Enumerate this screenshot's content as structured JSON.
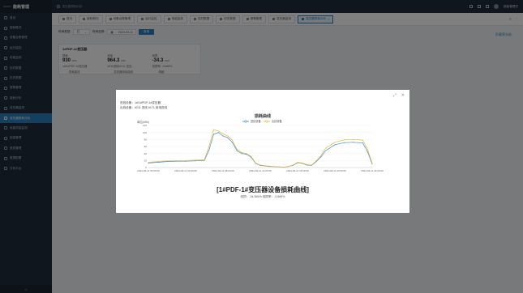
{
  "app": {
    "logo_text": "HNDM",
    "system_name": "能耗管理"
  },
  "sidebar": {
    "items": [
      {
        "label": "首页"
      },
      {
        "label": "能耗概况"
      },
      {
        "label": "设备台账管理"
      },
      {
        "label": "运行监控"
      },
      {
        "label": "电能监测"
      },
      {
        "label": "实时数据"
      },
      {
        "label": "历史数据"
      },
      {
        "label": "报警管理"
      },
      {
        "label": "能耗分析"
      },
      {
        "label": "变压器监测"
      },
      {
        "label": "变压器损耗分析",
        "active": true
      },
      {
        "label": "电能质量监测"
      },
      {
        "label": "用量管理"
      },
      {
        "label": "报表管理"
      },
      {
        "label": "数据配置"
      },
      {
        "label": "分析平台"
      }
    ],
    "collapse_glyph": "«"
  },
  "topbar": {
    "search_placeholder": "变压器损耗分析",
    "user_name": "超级管理员"
  },
  "tabs": {
    "items": [
      {
        "label": "首页"
      },
      {
        "label": "能耗概况"
      },
      {
        "label": "设备台账管理"
      },
      {
        "label": "运行监控"
      },
      {
        "label": "电能监测"
      },
      {
        "label": "实时数据"
      },
      {
        "label": "历史数据"
      },
      {
        "label": "报警管理"
      },
      {
        "label": "变压器监测"
      },
      {
        "label": "变压器损耗分析",
        "active": true
      }
    ]
  },
  "filter": {
    "type_label": "时间类型:",
    "type_value": "日",
    "date_label": "时间选择:",
    "date_value": "2024-03-11",
    "query_button": "查询"
  },
  "back_link": "负载率分析",
  "card": {
    "title": "1#PDF-1#变压器",
    "more": "⋮",
    "col1": {
      "head": "损耗",
      "value": "930",
      "unit": "kWh",
      "line": "1#/1#PDF-1#变压器",
      "foot": "损耗曲线"
    },
    "col2": {
      "head": "用电",
      "value": "964.3",
      "unit": "kWh",
      "line": "#211进线/#211 变压...",
      "foot": "变压器用电曲线"
    },
    "col3": {
      "head": "线损",
      "value": "-34.3",
      "unit": "kWh",
      "line": "线损率: -3.666%",
      "foot": "明细"
    }
  },
  "modal": {
    "info_line1": "进线设备：1#/1#PDF-1#变压器",
    "info_line2": "出线设备：#211 进线 #171 用电进线",
    "chart_title": "损耗曲线",
    "big_title": "[1#PDF-1#变压器设备损耗曲线]",
    "subtitle": "线损：-34.3kWh 线损率：-3.666%"
  },
  "chart_data": {
    "type": "line",
    "title": "损耗曲线",
    "ylabel": "单位(kWh)",
    "ylim": [
      0,
      120
    ],
    "yticks": [
      0,
      20,
      40,
      60,
      80,
      100,
      120
    ],
    "xticks": [
      "2024-03-11 00:00:00",
      "2024-03-11 04:00:00",
      "2024-03-11 08:00:00",
      "2024-03-11 12:00:00",
      "2024-03-11 16:00:00",
      "2024-03-11 20:00:00",
      "2024-03-11 24:00:00"
    ],
    "series": [
      {
        "name": "进线设备",
        "color": "#3a8ec8",
        "x": [
          0,
          1,
          2,
          3,
          4,
          5,
          6,
          6.5,
          7,
          7.5,
          8,
          8.5,
          9,
          9.5,
          10,
          10.5,
          11,
          11.5,
          12,
          13,
          14,
          14.5,
          15,
          15.5,
          16,
          16.5,
          17,
          17.5,
          18,
          18.5,
          19,
          20,
          21,
          22,
          23,
          23.5,
          24
        ],
        "values": [
          13,
          15,
          17,
          18,
          18,
          19,
          20,
          50,
          95,
          100,
          90,
          85,
          72,
          48,
          40,
          38,
          30,
          12,
          6,
          3,
          2,
          1,
          3,
          6,
          14,
          12,
          7,
          6,
          17,
          30,
          48,
          65,
          71,
          72,
          70,
          45,
          10
        ]
      },
      {
        "name": "出线设备",
        "color": "#e8b73a",
        "x": [
          0,
          1,
          2,
          3,
          4,
          5,
          6,
          6.5,
          7,
          7.5,
          8,
          8.5,
          9,
          9.5,
          10,
          10.5,
          11,
          11.5,
          12,
          13,
          14,
          14.5,
          15,
          15.5,
          16,
          16.5,
          17,
          17.5,
          18,
          18.5,
          19,
          20,
          21,
          22,
          23,
          23.5,
          24
        ],
        "values": [
          15,
          17,
          19,
          20,
          20,
          21,
          22,
          60,
          108,
          104,
          96,
          90,
          78,
          52,
          43,
          40,
          32,
          13,
          7,
          4,
          2,
          1,
          3,
          7,
          15,
          13,
          8,
          7,
          19,
          34,
          55,
          72,
          79,
          80,
          78,
          52,
          12
        ]
      }
    ],
    "legend": "top-center"
  }
}
